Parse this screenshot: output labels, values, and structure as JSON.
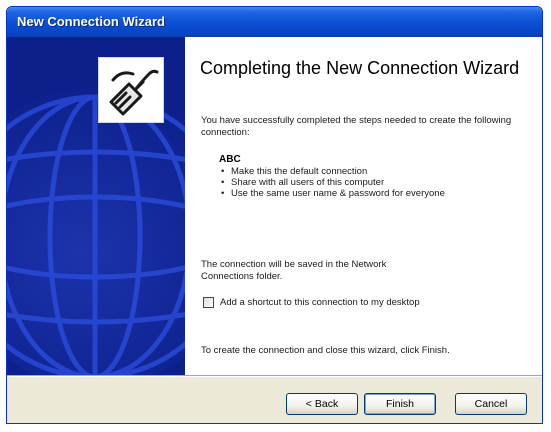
{
  "window": {
    "title": "New Connection Wizard"
  },
  "main": {
    "heading": "Completing the New Connection Wizard",
    "intro": "You have successfully completed the steps needed to create the following connection:",
    "connection_name": "ABC",
    "options": [
      "Make this the default connection",
      "Share with all users of this computer",
      "Use the same user name & password for everyone"
    ],
    "saved_note": "The connection will be saved in the Network Connections folder.",
    "shortcut_checkbox_label": "Add a shortcut to this connection to my desktop",
    "shortcut_checked": false,
    "finish_instruction": "To create the connection and close this wizard, click Finish."
  },
  "buttons": {
    "back": "< Back",
    "finish": "Finish",
    "cancel": "Cancel"
  },
  "colors": {
    "titlebar": "#0a4fd4",
    "side_panel": "#0c1f8a",
    "dialog_face": "#ece9d8"
  },
  "icons": {
    "wizard_icon": "network-cable-plug-icon",
    "side_art": "globe-graphic"
  }
}
